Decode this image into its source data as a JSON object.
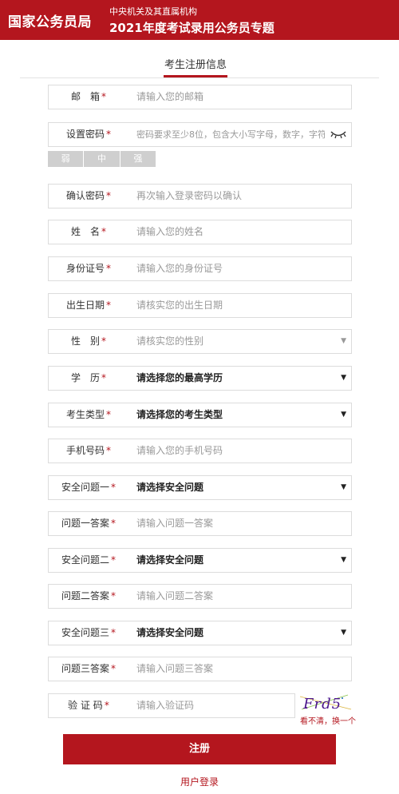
{
  "header": {
    "brand": "国家公务员局",
    "subtitle_small": "中央机关及其直属机构",
    "subtitle_large": "2021年度考试录用公务员专题"
  },
  "tab": {
    "label": "考生注册信息"
  },
  "fields": {
    "email": {
      "label": "邮　箱",
      "required": "*",
      "placeholder": "请输入您的邮箱"
    },
    "password": {
      "label": "设置密码",
      "required": "*",
      "placeholder": "密码要求至少8位，包含大小写字母，数字，字符"
    },
    "strength": {
      "weak": "弱",
      "medium": "中",
      "strong": "强"
    },
    "confirm_password": {
      "label": "确认密码",
      "required": "*",
      "placeholder": "再次输入登录密码以确认"
    },
    "name": {
      "label": "姓　名",
      "required": "*",
      "placeholder": "请输入您的姓名"
    },
    "id_number": {
      "label": "身份证号",
      "required": "*",
      "placeholder": "请输入您的身份证号"
    },
    "birth_date": {
      "label": "出生日期",
      "required": "*",
      "placeholder": "请核实您的出生日期"
    },
    "gender": {
      "label": "性　别",
      "required": "*",
      "placeholder": "请核实您的性别"
    },
    "education": {
      "label": "学　历",
      "required": "*",
      "value": "请选择您的最高学历"
    },
    "candidate_type": {
      "label": "考生类型",
      "required": "*",
      "value": "请选择您的考生类型"
    },
    "phone": {
      "label": "手机号码",
      "required": "*",
      "placeholder": "请输入您的手机号码"
    },
    "security_q1": {
      "label": "安全问题一",
      "required": "*",
      "value": "请选择安全问题"
    },
    "answer_1": {
      "label": "问题一答案",
      "required": "*",
      "placeholder": "请输入问题一答案"
    },
    "security_q2": {
      "label": "安全问题二",
      "required": "*",
      "value": "请选择安全问题"
    },
    "answer_2": {
      "label": "问题二答案",
      "required": "*",
      "placeholder": "请输入问题二答案"
    },
    "security_q3": {
      "label": "安全问题三",
      "required": "*",
      "value": "请选择安全问题"
    },
    "answer_3": {
      "label": "问题三答案",
      "required": "*",
      "placeholder": "请输入问题三答案"
    },
    "captcha": {
      "label": "验 证 码",
      "required": "*",
      "placeholder": "请输入验证码",
      "image_text": "Frd5",
      "refresh": "看不清，换一个"
    }
  },
  "actions": {
    "register": "注册",
    "login": "用户登录"
  },
  "colors": {
    "brand_red": "#b4161e",
    "border": "#dcdcdc",
    "placeholder": "#999999"
  }
}
